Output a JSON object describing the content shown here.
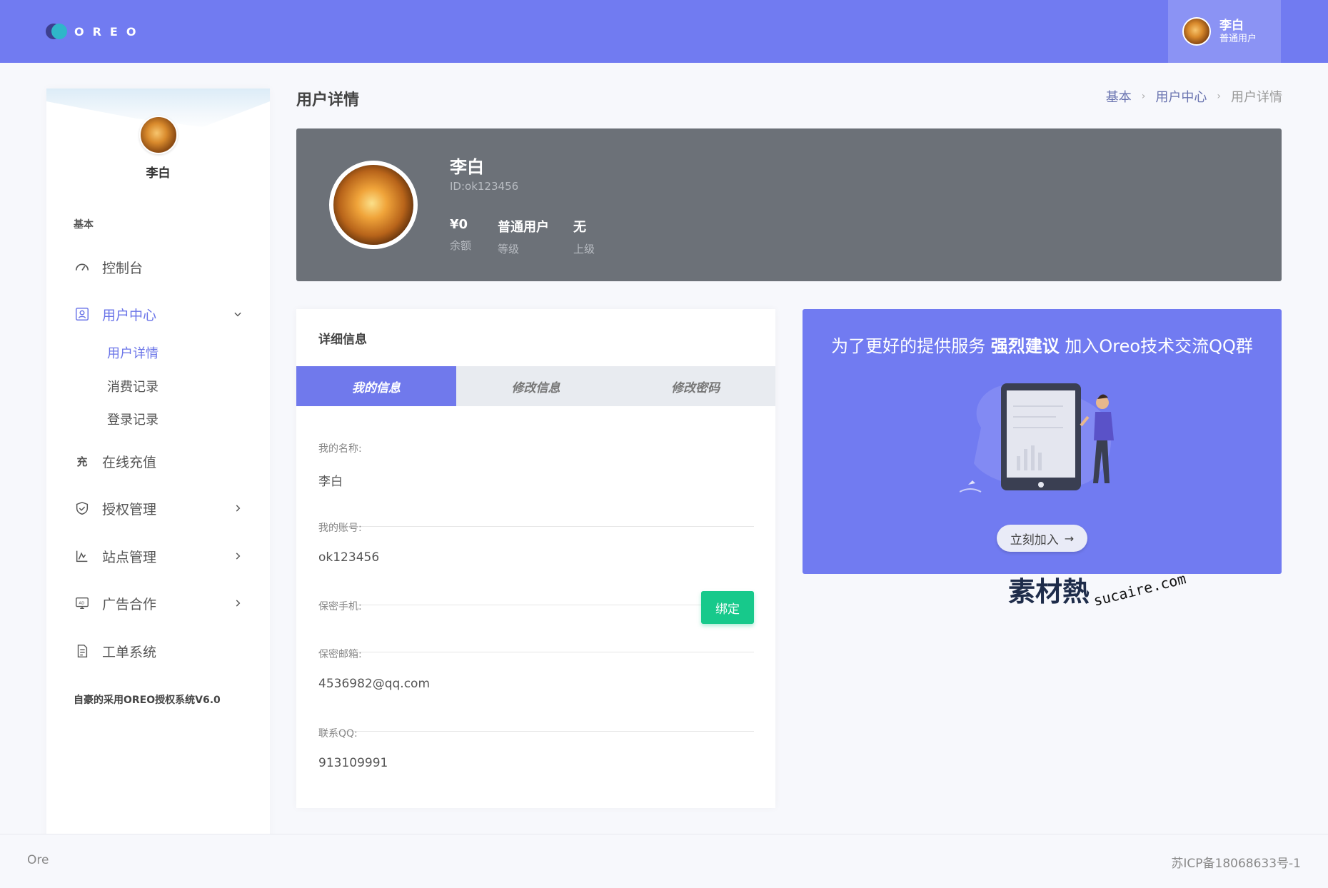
{
  "app": {
    "logo_text": "OREO"
  },
  "header": {
    "user_name": "李白",
    "user_level": "普通用户"
  },
  "sidebar": {
    "profile_name": "李白",
    "section_label": "基本",
    "items": [
      {
        "label": "控制台",
        "icon": "dashboard-icon"
      },
      {
        "label": "用户中心",
        "icon": "user-card-icon"
      },
      {
        "label": "在线充值",
        "icon": "recharge-icon"
      },
      {
        "label": "授权管理",
        "icon": "shield-icon"
      },
      {
        "label": "站点管理",
        "icon": "chart-icon"
      },
      {
        "label": "广告合作",
        "icon": "ad-icon"
      },
      {
        "label": "工单系统",
        "icon": "ticket-icon"
      }
    ],
    "sub_items": [
      "用户详情",
      "消费记录",
      "登录记录"
    ],
    "footer_text": "自豪的采用OREO授权系统V6.0",
    "recharge_glyph": "充"
  },
  "page": {
    "title": "用户详情",
    "breadcrumb": [
      "基本",
      "用户中心",
      "用户详情"
    ]
  },
  "profile": {
    "name": "李白",
    "id_text": "ID:ok123456",
    "stats": [
      {
        "value": "¥0",
        "label": "余额"
      },
      {
        "value": "普通用户",
        "label": "等级"
      },
      {
        "value": "无",
        "label": "上级"
      }
    ]
  },
  "detail": {
    "heading": "详细信息",
    "tabs": [
      "我的信息",
      "修改信息",
      "修改密码"
    ],
    "fields": [
      {
        "label": "我的名称:",
        "value": "李白"
      },
      {
        "label": "我的账号:",
        "value": "ok123456"
      },
      {
        "label": "保密手机:",
        "value": ""
      },
      {
        "label": "保密邮箱:",
        "value": "4536982@qq.com"
      },
      {
        "label": "联系QQ:",
        "value": "913109991"
      }
    ],
    "bind_label": "绑定"
  },
  "promo": {
    "title_prefix": "为了更好的提供服务",
    "title_bold": "强烈建议",
    "title_suffix": "加入Oreo技术交流QQ群",
    "button_label": "立刻加入"
  },
  "watermark": {
    "cn": "素材熱",
    "en": "sucaire.com"
  },
  "footer": {
    "left": "Ore",
    "right": "苏ICP备18068633号-1"
  },
  "colors": {
    "primary": "#717bf1",
    "banner": "#6c7178",
    "success": "#17c98b"
  }
}
